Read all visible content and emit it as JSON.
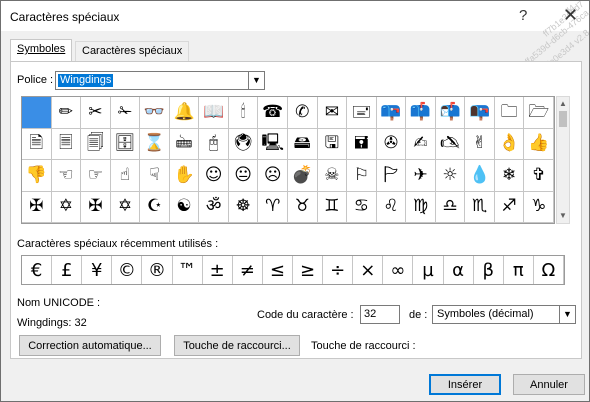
{
  "window": {
    "title": "Caractères spéciaux",
    "help_glyph": "?",
    "close_glyph": "✕",
    "watermark_lines": [
      "ff4",
      "ff7b1e3ebd7",
      "ffa539d-d6cb-476ca",
      "fe0e3d4 v2.8 - 7c76"
    ]
  },
  "tabs": [
    {
      "label": "Symboles",
      "active": true
    },
    {
      "label": "Caractères spéciaux",
      "active": false
    }
  ],
  "font": {
    "label": "Police :",
    "value": "Wingdings"
  },
  "symbol_grid": {
    "selected_index": 0,
    "icons": [
      "blank-selected",
      "pencil-icon",
      "scissors-icon",
      "scissors-open-icon",
      "eyeglasses-icon",
      "bell-icon",
      "open-book-icon",
      "candle-icon",
      "telephone-icon",
      "telephone-handset-icon",
      "envelope-icon",
      "envelope-text-icon",
      "mailbox-closed-icon",
      "mailbox-flag-icon",
      "mailbox-open-icon",
      "mailbox-open-flag-icon",
      "folder-icon",
      "folder-open-icon",
      "page-icon",
      "page-lined-icon",
      "pages-stack-icon",
      "file-cabinet-icon",
      "hourglass-icon",
      "keyboard-icon",
      "mouse-icon",
      "trackball-icon",
      "computer-icon",
      "hard-disk-icon",
      "floppy-disk-icon",
      "floppy-save-icon",
      "tape-drive-icon",
      "hand-writing-icon",
      "hand-writing-left-icon",
      "victory-hand-icon",
      "ok-hand-icon",
      "thumbs-up-icon",
      "thumbs-down-icon",
      "point-left-icon",
      "point-right-icon",
      "point-up-icon",
      "point-down-icon",
      "raised-hand-icon",
      "smiley-icon",
      "neutral-face-icon",
      "frowning-face-icon",
      "bomb-icon",
      "skull-crossbones-icon",
      "flag-icon",
      "pennant-icon",
      "airplane-icon",
      "sun-icon",
      "droplet-icon",
      "snowflake-icon",
      "latin-cross-icon",
      "cross-outline-icon",
      "celtic-cross-icon",
      "maltese-cross-icon",
      "star-of-david-icon",
      "star-crescent-icon",
      "yin-yang-icon",
      "om-icon",
      "dharma-wheel-icon",
      "aries-icon",
      "taurus-icon",
      "gemini-icon",
      "cancer-icon",
      "leo-icon",
      "virgo-icon",
      "libra-icon",
      "scorpio-icon",
      "sagittarius-icon",
      "capricorn-icon"
    ],
    "glyphs": [
      "",
      "✏",
      "✂",
      "✁",
      "👓",
      "🔔",
      "📖",
      "🕯",
      "☎",
      "✆",
      "✉",
      "🖃",
      "📪",
      "📫",
      "📬",
      "📭",
      "🗀",
      "🗁",
      "🗎",
      "🗏",
      "🗐",
      "🗄",
      "⌛",
      "🖮",
      "🖰",
      "🖲",
      "🖳",
      "🖴",
      "🖫",
      "🖬",
      "✇",
      "✍",
      "🖎",
      "✌",
      "👌",
      "👍",
      "👎",
      "☜",
      "☞",
      "☝",
      "☟",
      "✋",
      "☺",
      "😐",
      "☹",
      "💣",
      "☠",
      "⚐",
      "🏱",
      "✈",
      "☼",
      "💧",
      "❄",
      "✞",
      "✠",
      "✡",
      "✠",
      "✡",
      "☪",
      "☯",
      "ॐ",
      "☸",
      "♈",
      "♉",
      "♊",
      "♋",
      "♌",
      "♍",
      "♎",
      "♏",
      "♐",
      "♑"
    ]
  },
  "recent": {
    "label": "Caractères spéciaux récemment utilisés :",
    "symbols": [
      "€",
      "£",
      "¥",
      "©",
      "®",
      "™",
      "±",
      "≠",
      "≤",
      "≥",
      "÷",
      "×",
      "∞",
      "µ",
      "α",
      "β",
      "π",
      "Ω"
    ]
  },
  "unicode": {
    "name_label": "Nom UNICODE :",
    "name_value": "Wingdings: 32"
  },
  "char_code": {
    "label": "Code du caractère :",
    "value": "32",
    "from_label": "de :",
    "from_value": "Symboles (décimal)"
  },
  "buttons": {
    "autocorrect": "Correction automatique...",
    "shortcut_key": "Touche de raccourci...",
    "shortcut_label": "Touche de raccourci :",
    "insert": "Insérer",
    "cancel": "Annuler"
  }
}
